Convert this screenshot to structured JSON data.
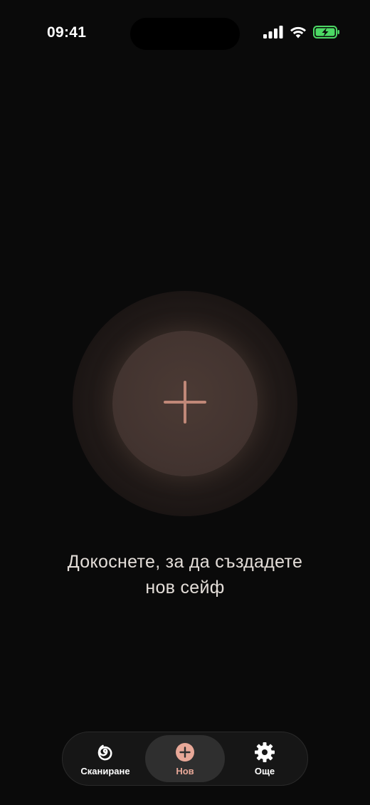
{
  "status_bar": {
    "time": "09:41"
  },
  "main": {
    "create_icon": "plus-icon",
    "prompt_line1": "Докоснете, за да създадете",
    "prompt_line2": "нов сейф"
  },
  "tab_bar": {
    "tabs": [
      {
        "label": "Сканиране",
        "icon": "spiral-icon",
        "active": false
      },
      {
        "label": "Нов",
        "icon": "plus-circle-icon",
        "active": true
      },
      {
        "label": "Още",
        "icon": "gear-icon",
        "active": false
      }
    ]
  },
  "colors": {
    "background": "#0a0a0a",
    "accent": "#e8a898",
    "plus_stroke": "#c08878",
    "battery_green": "#4cd964"
  }
}
